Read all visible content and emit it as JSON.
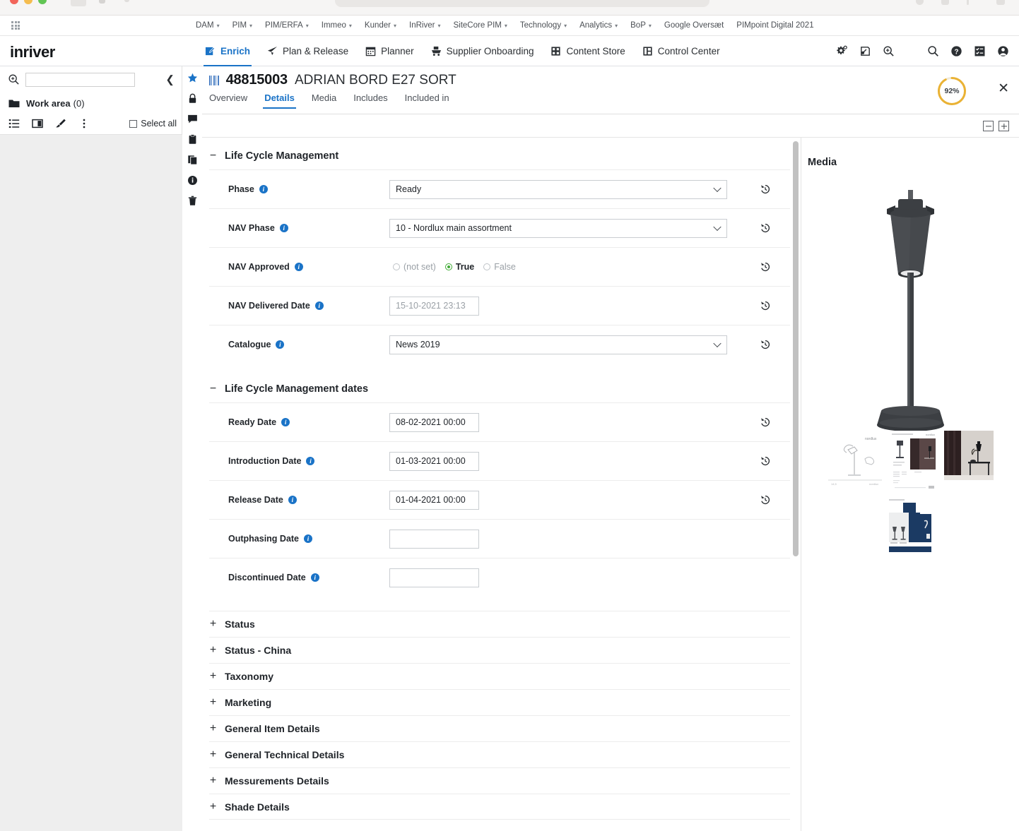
{
  "browser": {
    "traffic_lights": [
      "close",
      "minimize",
      "maximize"
    ]
  },
  "bookmarks_bar": {
    "apps_icon": "apps-grid-icon",
    "items": [
      {
        "label": "DAM",
        "has_menu": true
      },
      {
        "label": "PIM",
        "has_menu": true
      },
      {
        "label": "PIM/ERFA",
        "has_menu": true
      },
      {
        "label": "Immeo",
        "has_menu": true
      },
      {
        "label": "Kunder",
        "has_menu": true
      },
      {
        "label": "InRiver",
        "has_menu": true
      },
      {
        "label": "SiteCore PIM",
        "has_menu": true
      },
      {
        "label": "Technology",
        "has_menu": true
      },
      {
        "label": "Analytics",
        "has_menu": true
      },
      {
        "label": "BoP",
        "has_menu": true
      },
      {
        "label": "Google Oversæt",
        "has_menu": false
      },
      {
        "label": "PIMpoint Digital 2021",
        "has_menu": false
      }
    ]
  },
  "app_nav": {
    "brand": "inriver",
    "active_color": "#1a73c7",
    "items": [
      {
        "label": "Enrich",
        "icon": "edit-square-icon",
        "active": true
      },
      {
        "label": "Plan & Release",
        "icon": "paper-plane-icon",
        "active": false
      },
      {
        "label": "Planner",
        "icon": "calendar-icon",
        "active": false
      },
      {
        "label": "Supplier Onboarding",
        "icon": "supplier-cart-icon",
        "active": false
      },
      {
        "label": "Content Store",
        "icon": "content-store-icon",
        "active": false
      },
      {
        "label": "Control Center",
        "icon": "control-center-icon",
        "active": false
      }
    ],
    "tools": [
      {
        "icon": "settings-gear-icon"
      },
      {
        "icon": "import-export-icon"
      },
      {
        "icon": "zoom-search-icon"
      },
      {
        "icon": "search-icon"
      },
      {
        "icon": "help-circle-icon"
      },
      {
        "icon": "tasks-icon"
      },
      {
        "icon": "user-avatar-icon"
      }
    ]
  },
  "sidebar": {
    "search_value": "",
    "search_placeholder": "",
    "collapse_icon": "chevron-left-icon",
    "workarea_label": "Work area",
    "workarea_count": "(0)",
    "tools": [
      {
        "icon": "list-view-icon"
      },
      {
        "icon": "split-view-icon"
      },
      {
        "icon": "highlighter-icon"
      },
      {
        "icon": "more-vertical-icon"
      }
    ],
    "select_all_label": "Select all",
    "select_all_checked": false
  },
  "action_rail": [
    {
      "icon": "star-icon",
      "active": true
    },
    {
      "icon": "lock-icon",
      "active": false
    },
    {
      "icon": "comment-icon",
      "active": false
    },
    {
      "icon": "clipboard-icon",
      "active": false
    },
    {
      "icon": "copy-icon",
      "active": false
    },
    {
      "icon": "info-icon",
      "active": false
    },
    {
      "icon": "trash-icon",
      "active": false
    }
  ],
  "entity": {
    "id": "48815003",
    "name": "ADRIAN BORD E27 SORT",
    "completeness": "92%",
    "completeness_value": 92,
    "completeness_color": "#eab234",
    "close_icon": "close-icon",
    "tabs": [
      {
        "label": "Overview",
        "active": false
      },
      {
        "label": "Details",
        "active": true
      },
      {
        "label": "Media",
        "active": false
      },
      {
        "label": "Includes",
        "active": false
      },
      {
        "label": "Included in",
        "active": false
      }
    ]
  },
  "section_controls": [
    {
      "icon": "collapse-all-icon"
    },
    {
      "icon": "expand-all-icon"
    }
  ],
  "form": {
    "sections": [
      {
        "title": "Life Cycle Management",
        "expanded": true,
        "sign": "−",
        "fields": [
          {
            "label": "Phase",
            "type": "select",
            "value": "Ready",
            "has_history": true
          },
          {
            "label": "NAV Phase",
            "type": "select",
            "value": "10 - Nordlux main assortment",
            "has_history": true
          },
          {
            "label": "NAV Approved",
            "type": "radio",
            "has_history": true,
            "options": [
              {
                "label": "(not set)",
                "selected": false
              },
              {
                "label": "True",
                "selected": true
              },
              {
                "label": "False",
                "selected": false
              }
            ]
          },
          {
            "label": "NAV Delivered Date",
            "type": "text",
            "value": "15-10-2021 23:13",
            "muted": true,
            "has_history": true
          },
          {
            "label": "Catalogue",
            "type": "select",
            "value": "News 2019",
            "has_history": true
          }
        ]
      },
      {
        "title": "Life Cycle Management dates",
        "expanded": true,
        "sign": "−",
        "fields": [
          {
            "label": "Ready Date",
            "type": "text",
            "value": "08-02-2021 00:00",
            "muted": false,
            "has_history": true
          },
          {
            "label": "Introduction Date",
            "type": "text",
            "value": "01-03-2021 00:00",
            "muted": false,
            "has_history": true
          },
          {
            "label": "Release Date",
            "type": "text",
            "value": "01-04-2021 00:00",
            "muted": false,
            "has_history": true
          },
          {
            "label": "Outphasing Date",
            "type": "text",
            "value": "",
            "muted": false,
            "has_history": false
          },
          {
            "label": "Discontinued Date",
            "type": "text",
            "value": "",
            "muted": false,
            "has_history": false
          }
        ]
      }
    ],
    "collapsed_sections": [
      {
        "title": "Status",
        "sign": "+"
      },
      {
        "title": "Status - China",
        "sign": "+"
      },
      {
        "title": "Taxonomy",
        "sign": "+"
      },
      {
        "title": "Marketing",
        "sign": "+"
      },
      {
        "title": "General Item Details",
        "sign": "+"
      },
      {
        "title": "General Technical Details",
        "sign": "+"
      },
      {
        "title": "Messurements Details",
        "sign": "+"
      },
      {
        "title": "Shade Details",
        "sign": "+"
      }
    ]
  },
  "media": {
    "title": "Media",
    "hero_alt": "black table lamp product shot",
    "thumbnails": [
      {
        "name": "technical-line-drawing"
      },
      {
        "name": "spec-sheet"
      },
      {
        "name": "lifestyle-photo"
      },
      {
        "name": "packaging-sheet"
      }
    ]
  }
}
